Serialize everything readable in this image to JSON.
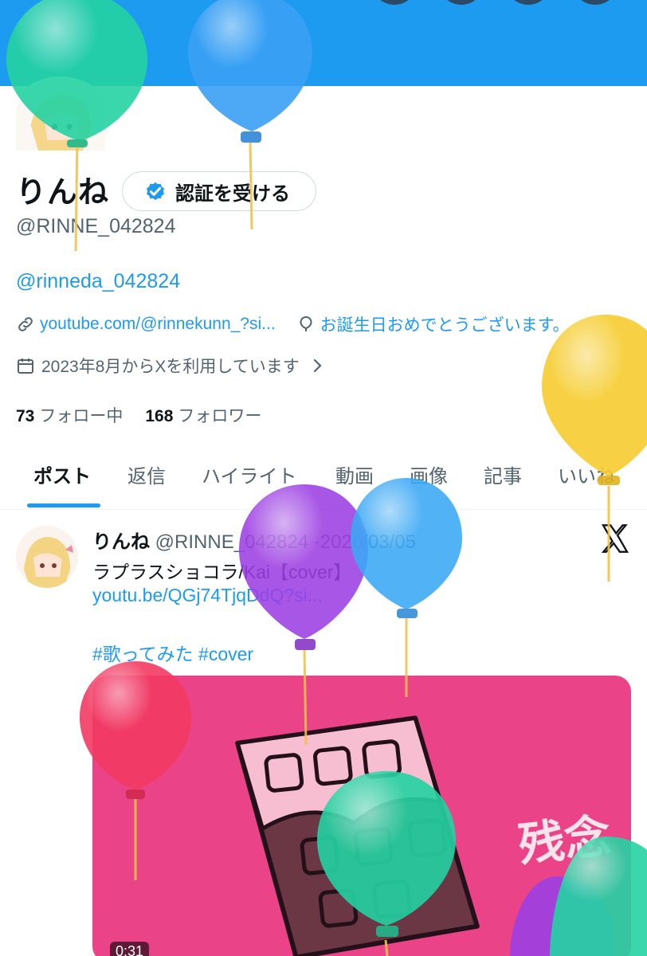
{
  "profile": {
    "display_name": "りんね",
    "verify_button_label": "認証を受ける",
    "handle": "@RINNE_042824",
    "bio_link": "@rinneda_042824",
    "website": "youtube.com/@rinnekunn_?si...",
    "location": "お誕生日おめでとうございます。",
    "joined": "2023年8月からXを利用しています",
    "following_count": "73",
    "following_label": "フォロー中",
    "followers_count": "168",
    "followers_label": "フォロワー"
  },
  "tabs": [
    {
      "label": "ポスト"
    },
    {
      "label": "返信"
    },
    {
      "label": "ハイライト"
    },
    {
      "label": "動画"
    },
    {
      "label": "画像"
    },
    {
      "label": "記事"
    },
    {
      "label": "いいね"
    }
  ],
  "post": {
    "author_name": "りんね",
    "author_handle": "@RINNE_042824",
    "separator": "·",
    "date": "2026/03/05",
    "text": "ラプラスショコラ/Kai【cover】",
    "link": "youtu.be/QGj74TjqDdQ?si...",
    "hashtags": "#歌ってみた #cover",
    "media_overlay_text": "残念",
    "video_duration": "0:31"
  },
  "colors": {
    "accent": "#1d9bf0",
    "banner": "#1d9bf0",
    "media_bg": "#ea4387"
  },
  "icons": [
    "verified-badge-icon",
    "link-icon",
    "balloon-icon",
    "calendar-icon",
    "chevron-right-icon",
    "x-logo-icon"
  ]
}
